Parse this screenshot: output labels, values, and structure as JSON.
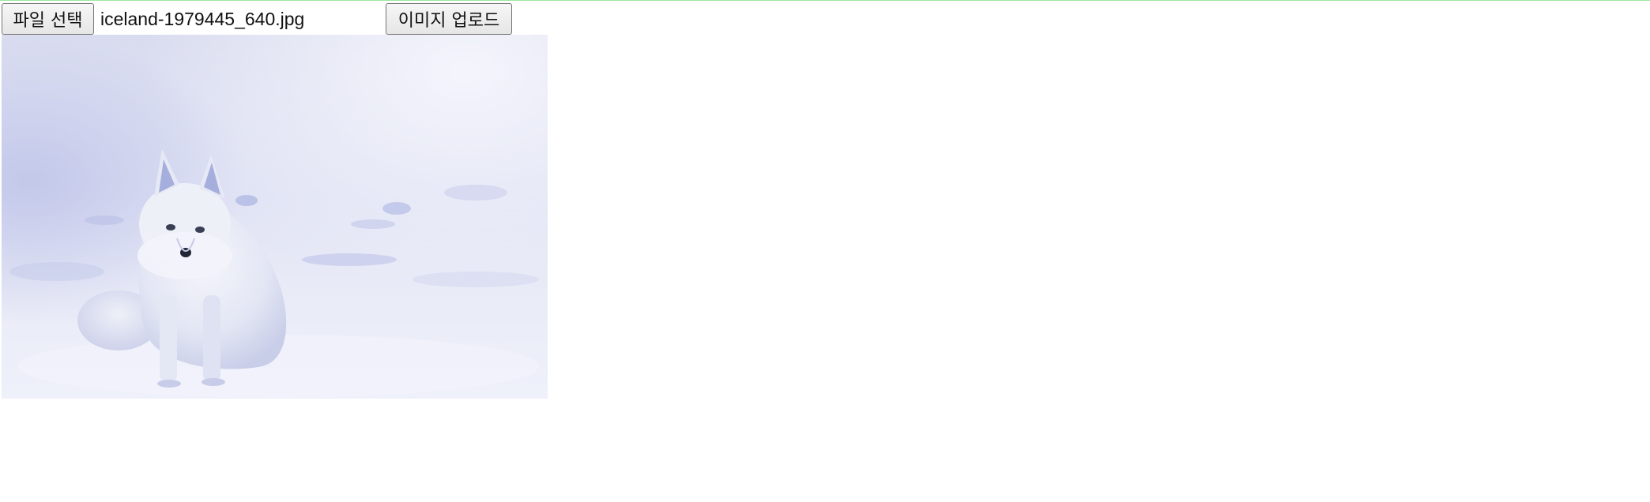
{
  "uploader": {
    "choose_button_label": "파일 선택",
    "selected_file_name": "iceland-1979445_640.jpg",
    "upload_button_label": "이미지 업로드"
  },
  "preview": {
    "subject_icon": "arctic-fox-photo"
  }
}
